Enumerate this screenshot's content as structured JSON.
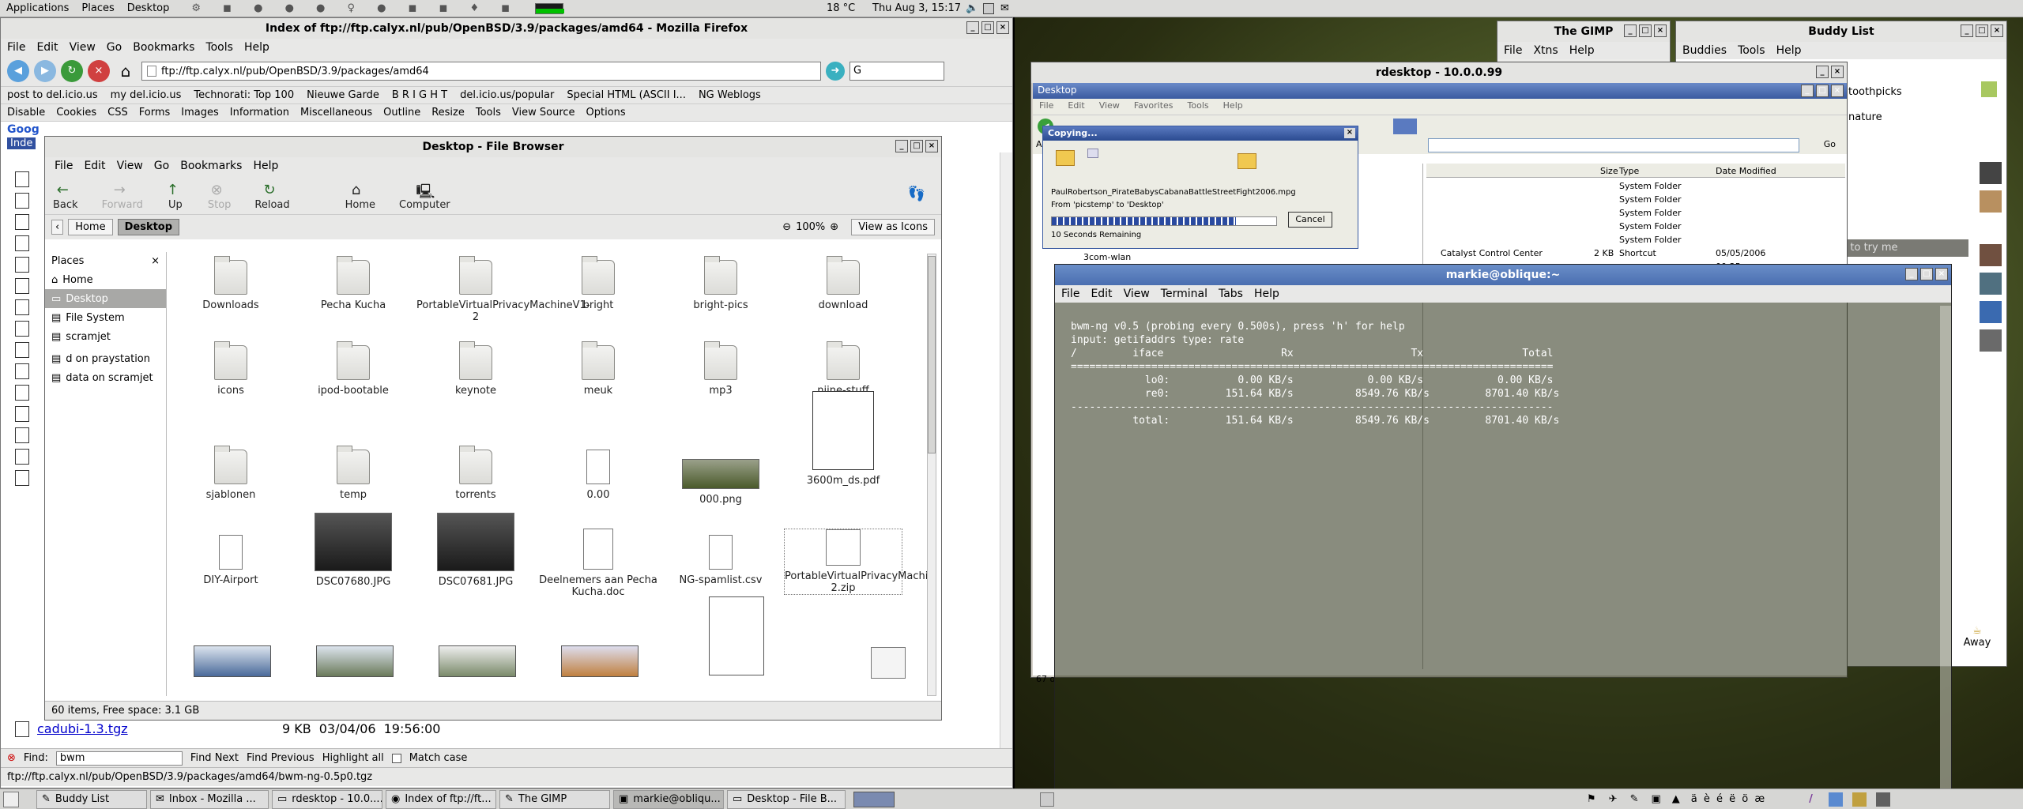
{
  "panel": {
    "menus": [
      "Applications",
      "Places",
      "Desktop"
    ],
    "weather": "18 °C",
    "clock": "Thu Aug  3, 15:17"
  },
  "firefox": {
    "title": "Index of ftp://ftp.calyx.nl/pub/OpenBSD/3.9/packages/amd64 - Mozilla Firefox",
    "menus": [
      "File",
      "Edit",
      "View",
      "Go",
      "Bookmarks",
      "Tools",
      "Help"
    ],
    "url": "ftp://ftp.calyx.nl/pub/OpenBSD/3.9/packages/amd64",
    "search_placeholder": "G",
    "bookmarks": [
      "post to del.icio.us",
      "my del.icio.us",
      "Technorati: Top 100",
      "Nieuwe Garde",
      "B R I G H T",
      "del.icio.us/popular",
      "Special HTML (ASCII I...",
      "NG Weblogs"
    ],
    "devbar": [
      "Disable",
      "Cookies",
      "CSS",
      "Forms",
      "Images",
      "Information",
      "Miscellaneous",
      "Outline",
      "Resize",
      "Tools",
      "View Source",
      "Options"
    ],
    "listing_visible": {
      "name": "cadubi-1.3.tgz",
      "size": "9 KB",
      "date": "03/04/06",
      "time": "19:56:00"
    },
    "find_label": "Find:",
    "find_value": "bwm",
    "find_next": "Find Next",
    "find_prev": "Find Previous",
    "highlight": "Highlight all",
    "match_case": "Match case",
    "status": "ftp://ftp.calyx.nl/pub/OpenBSD/3.9/packages/amd64/bwm-ng-0.5p0.tgz",
    "google_tab": "Goog",
    "index_tab": "Inde"
  },
  "filebrowser": {
    "title": "Desktop - File Browser",
    "menus": [
      "File",
      "Edit",
      "View",
      "Go",
      "Bookmarks",
      "Help"
    ],
    "toolbar": [
      "Back",
      "Forward",
      "Up",
      "Stop",
      "Reload",
      "Home",
      "Computer"
    ],
    "crumbs": [
      "Home",
      "Desktop"
    ],
    "zoom": "100%",
    "view_as": "View as Icons",
    "places_label": "Places",
    "places": [
      "Home",
      "Desktop",
      "File System",
      "scramjet",
      "d on praystation",
      "data on scramjet"
    ],
    "items": [
      "Downloads",
      "Pecha Kucha",
      "PortableVirtualPrivacyMachineV1-2",
      "bright",
      "bright-pics",
      "download",
      "icons",
      "ipod-bootable",
      "keynote",
      "meuk",
      "mp3",
      "nijne-stuff",
      "sjablonen",
      "temp",
      "torrents",
      "0.00",
      "000.png",
      "3600m_ds.pdf",
      "DIY-Airport",
      "DSC07680.JPG",
      "DSC07681.JPG",
      "Deelnemers aan Pecha Kucha.doc",
      "NG-spamlist.csv",
      "PortableVirtualPrivacyMachineV1-2.zip"
    ],
    "status": "60 items, Free space: 3.1 GB"
  },
  "gimp": {
    "title": "The GIMP",
    "menus": [
      "File",
      "Xtns",
      "Help"
    ]
  },
  "buddy": {
    "title": "Buddy List",
    "menus": [
      "Buddies",
      "Tools",
      "Help"
    ],
    "entries": [
      "toothpicks",
      "nature"
    ],
    "hint": "g to try me",
    "away": "Away"
  },
  "rdesktop": {
    "title": "rdesktop - 10.0.0.99",
    "explorer_title": "Desktop",
    "explorer_menus": [
      "File",
      "Edit",
      "View",
      "Favorites",
      "Tools",
      "Help"
    ],
    "address_label": "Addr",
    "go": "Go",
    "columns": [
      "Size",
      "Type",
      "Date Modified"
    ],
    "rows": [
      {
        "type": "System Folder"
      },
      {
        "type": "System Folder"
      },
      {
        "type": "System Folder"
      },
      {
        "type": "System Folder"
      },
      {
        "type": "System Folder"
      },
      {
        "name": "Catalyst Control Center",
        "size": "2 KB",
        "type": "Shortcut",
        "date": "05/05/2006 00:25"
      }
    ],
    "tree_item": "3com-wlan",
    "copy_title": "Copying...",
    "copy_file": "PaulRobertson_PirateBabysCabanaBattleStreetFight2006.mpg",
    "copy_from": "From 'picstemp' to 'Desktop'",
    "copy_remaining": "10 Seconds Remaining",
    "copy_progress": 0.82,
    "cancel": "Cancel",
    "status_frag": "67 o"
  },
  "terminal": {
    "title": "markie@oblique:~",
    "menus": [
      "File",
      "Edit",
      "View",
      "Terminal",
      "Tabs",
      "Help"
    ],
    "lines": [
      "bwm-ng v0.5 (probing every 0.500s), press 'h' for help",
      "input: getifaddrs type: rate",
      "/         iface                   Rx                   Tx                Total",
      "==============================================================================",
      "            lo0:           0.00 KB/s            0.00 KB/s            0.00 KB/s",
      "            re0:         151.64 KB/s          8549.76 KB/s         8701.40 KB/s",
      "------------------------------------------------------------------------------",
      "          total:         151.64 KB/s          8549.76 KB/s         8701.40 KB/s"
    ]
  },
  "taskbar": {
    "tasks": [
      "Buddy List",
      "Inbox - Mozilla ...",
      "rdesktop - 10.0....",
      "Index of ftp://ft...",
      "The GIMP",
      "markie@obliqu...",
      "Desktop - File B..."
    ],
    "accents": "ä  è  é  ë  ö  æ"
  }
}
